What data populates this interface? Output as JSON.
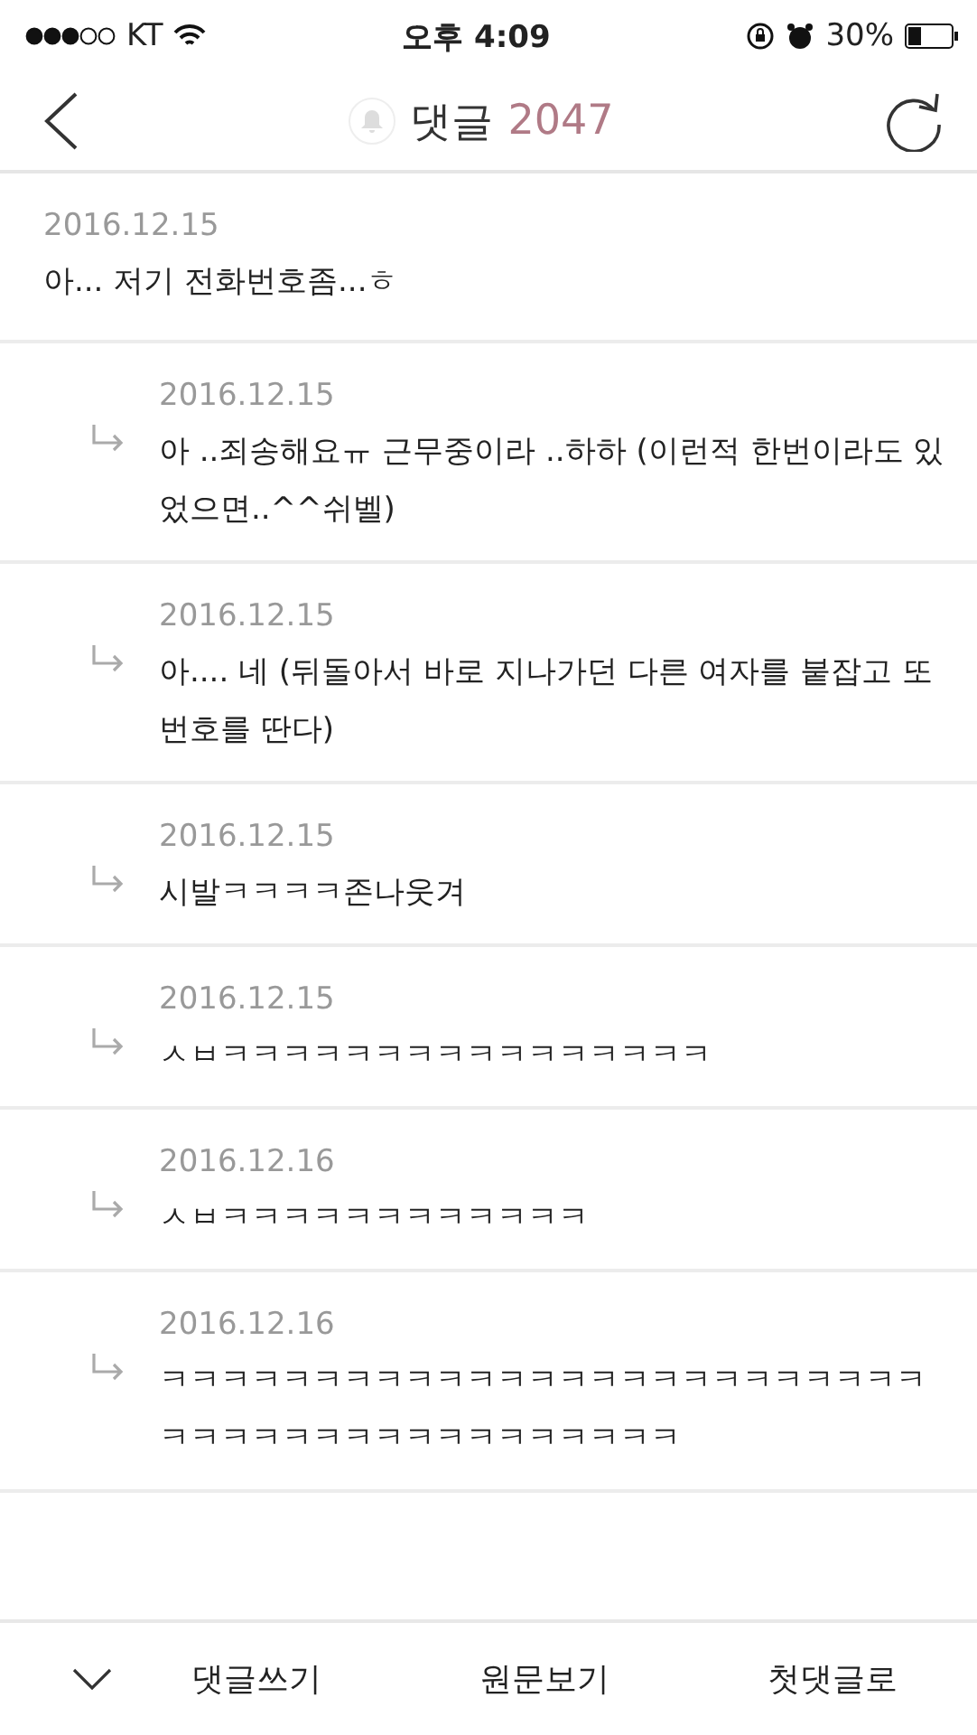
{
  "status_bar": {
    "carrier": "KT",
    "time": "오후 4:09",
    "battery": "30%"
  },
  "header": {
    "title": "댓글",
    "count": "2047"
  },
  "comments": [
    {
      "date": "2016.12.15",
      "text": "아... 저기 전화번호좀...ㅎ",
      "children": [
        {
          "date": "2016.12.15",
          "text": "아 ..죄송해요ㅠ 근무중이라 ..하하 (이런적 한번이라도 있었으면..^^쉬벨)"
        },
        {
          "date": "2016.12.15",
          "text": "아.... 네  (뒤돌아서 바로 지나가던 다른 여자를 붙잡고 또 번호를 딴다)"
        },
        {
          "date": "2016.12.15",
          "text": "시발ㅋㅋㅋㅋ존나웃겨"
        },
        {
          "date": "2016.12.15",
          "text": "ㅅㅂㅋㅋㅋㅋㅋㅋㅋㅋㅋㅋㅋㅋㅋㅋㅋㅋ"
        },
        {
          "date": "2016.12.16",
          "text": "ㅅㅂㅋㅋㅋㅋㅋㅋㅋㅋㅋㅋㅋㅋ"
        },
        {
          "date": "2016.12.16",
          "text": "ㅋㅋㅋㅋㅋㅋㅋㅋㅋㅋㅋㅋㅋㅋㅋㅋㅋㅋㅋㅋㅋㅋㅋㅋㅋㅋㅋㅋㅋㅋㅋㅋㅋㅋㅋㅋㅋㅋㅋㅋㅋㅋ"
        }
      ]
    }
  ],
  "bottom_bar": {
    "buttons": [
      "댓글쓰기",
      "원문보기",
      "첫댓글로"
    ]
  }
}
